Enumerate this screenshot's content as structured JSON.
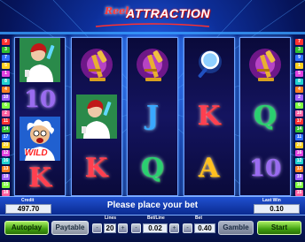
{
  "logo": {
    "word1": "Reel",
    "word2": "ATTRACTION"
  },
  "paylines": {
    "left": [
      "9",
      "3",
      "7",
      "5",
      "1",
      "8",
      "4",
      "10",
      "6",
      "2",
      "11",
      "14",
      "17",
      "20",
      "12",
      "16",
      "13",
      "19",
      "15",
      "18"
    ],
    "right": [
      "7",
      "3",
      "9",
      "1",
      "5",
      "8",
      "4",
      "2",
      "6",
      "10",
      "17",
      "14",
      "11",
      "20",
      "16",
      "12",
      "13",
      "19",
      "18",
      "15"
    ]
  },
  "reels": [
    [
      {
        "type": "pic",
        "icon": "doctor-woman-icon"
      },
      {
        "type": "letter",
        "glyph": "10",
        "cls": "c-10"
      },
      {
        "type": "pic",
        "icon": "wild-scientist-icon",
        "label": "WILD"
      },
      {
        "type": "letter",
        "glyph": "K",
        "cls": "c-K"
      }
    ],
    [
      {
        "type": "pic",
        "icon": "microscope-icon"
      },
      {
        "type": "pic",
        "icon": "doctor-woman-icon"
      },
      {
        "type": "letter",
        "glyph": "K",
        "cls": "c-K"
      }
    ],
    [
      {
        "type": "pic",
        "icon": "microscope-icon"
      },
      {
        "type": "letter",
        "glyph": "J",
        "cls": "c-J"
      },
      {
        "type": "letter",
        "glyph": "Q",
        "cls": "c-Q"
      }
    ],
    [
      {
        "type": "pic",
        "icon": "magnifier-icon"
      },
      {
        "type": "letter",
        "glyph": "K",
        "cls": "c-K"
      },
      {
        "type": "letter",
        "glyph": "A",
        "cls": "c-A"
      }
    ],
    [
      {
        "type": "pic",
        "icon": "microscope-icon"
      },
      {
        "type": "letter",
        "glyph": "Q",
        "cls": "c-Q"
      },
      {
        "type": "letter",
        "glyph": "10",
        "cls": "c-10"
      }
    ]
  ],
  "status": {
    "credit_label": "Credit",
    "credit_value": "497.70",
    "message": "Please place your bet",
    "last_win_label": "Last Win",
    "last_win_value": "0.10"
  },
  "controls": {
    "autoplay": "Autoplay",
    "paytable": "Paytable",
    "lines_label": "Lines",
    "lines_value": "20",
    "betline_label": "Bet/Line",
    "betline_value": "0.02",
    "bet_label": "Bet",
    "bet_value": "0.40",
    "gamble": "Gamble",
    "start": "Start",
    "minus": "-",
    "plus": "+"
  },
  "colors": {
    "tag_palette": [
      "#ff3030",
      "#30c030",
      "#3070ff",
      "#ffd020",
      "#e040e0",
      "#20d0d0",
      "#ff8020",
      "#a060ff",
      "#80ff40",
      "#ff60a0"
    ]
  }
}
